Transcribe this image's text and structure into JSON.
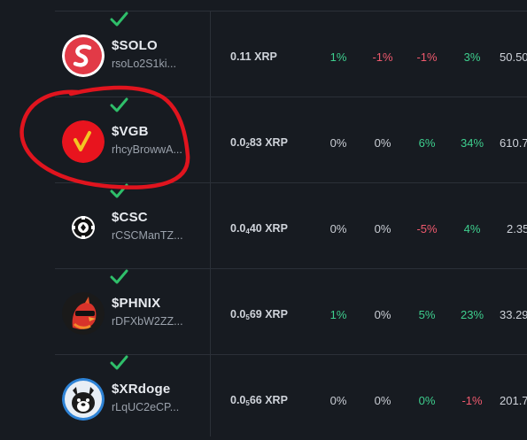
{
  "rows": [
    {
      "ticker": "$SOLO",
      "address": "rsoLo2S1ki...",
      "price_prefix": "0.11 XRP",
      "price_sub": "",
      "price_suffix": "",
      "pct": [
        "1%",
        "-1%",
        "-1%",
        "3%"
      ],
      "pct_kind": [
        "pos",
        "neg",
        "neg",
        "pos"
      ],
      "volume": "50.50",
      "icon": "solo-logo-icon"
    },
    {
      "ticker": "$VGB",
      "address": "rhcyBrowwA...",
      "price_prefix": "0.0",
      "price_sub": "2",
      "price_suffix": "83 XRP",
      "pct": [
        "0%",
        "0%",
        "6%",
        "34%"
      ],
      "pct_kind": [
        "neu",
        "neu",
        "pos",
        "pos"
      ],
      "volume": "610.7",
      "icon": "vgb-logo-icon"
    },
    {
      "ticker": "$CSC",
      "address": "rCSCManTZ...",
      "price_prefix": "0.0",
      "price_sub": "4",
      "price_suffix": "40 XRP",
      "pct": [
        "0%",
        "0%",
        "-5%",
        "4%"
      ],
      "pct_kind": [
        "neu",
        "neu",
        "neg",
        "pos"
      ],
      "volume": "2.35",
      "icon": "poker-chip-logo-icon"
    },
    {
      "ticker": "$PHNIX",
      "address": "rDFXbW2ZZ...",
      "price_prefix": "0.0",
      "price_sub": "5",
      "price_suffix": "69 XRP",
      "pct": [
        "1%",
        "0%",
        "5%",
        "23%"
      ],
      "pct_kind": [
        "pos",
        "neu",
        "pos",
        "pos"
      ],
      "volume": "33.29",
      "icon": "phoenix-logo-icon"
    },
    {
      "ticker": "$XRdoge",
      "address": "rLqUC2eCP...",
      "price_prefix": "0.0",
      "price_sub": "5",
      "price_suffix": "66 XRP",
      "pct": [
        "0%",
        "0%",
        "0%",
        "-1%"
      ],
      "pct_kind": [
        "neu",
        "neu",
        "pos",
        "neg"
      ],
      "volume": "201.7",
      "icon": "doge-logo-icon"
    }
  ],
  "colors": {
    "positive": "#3ecf8e",
    "negative": "#f05a6e",
    "annotation": "#e0141e",
    "verified": "#2fbf6a"
  }
}
